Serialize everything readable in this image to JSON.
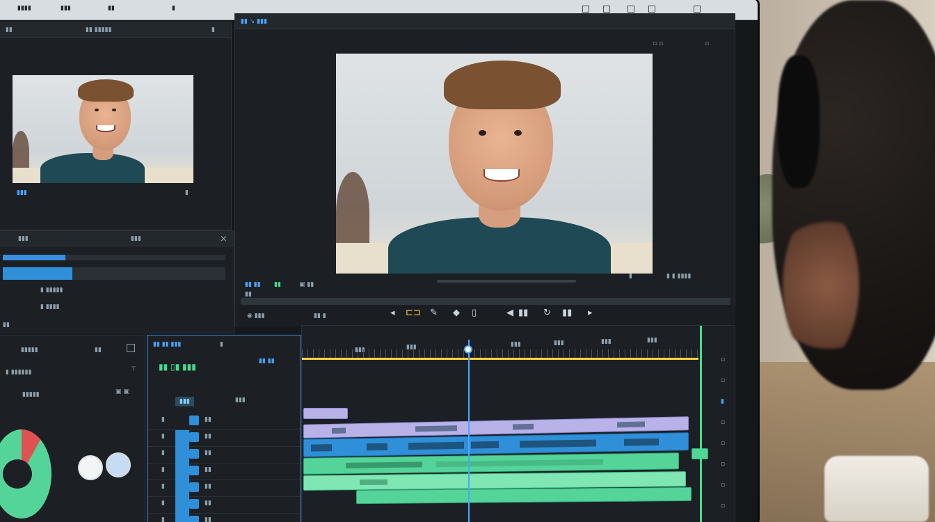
{
  "colors": {
    "accent": "#4aa3ff",
    "timeline_video": "#2f8fd8",
    "timeline_audio": "#55d49a",
    "timeline_title": "#b8b2e8",
    "playhead_line": "#ffd23f",
    "in_out_marker": "#3fe08a"
  },
  "source_monitor": {
    "icon_names": [
      "film-icon",
      "settings-icon"
    ]
  },
  "program_monitor": {
    "tab_label": "▮▮ ↘ ▮▮▮"
  },
  "effects_panel": {
    "close_icon": "×",
    "progress_fraction": 0.28
  },
  "transport": {
    "icons": [
      "play-icon",
      "step-back-icon",
      "loop-icon",
      "marker-icon",
      "in-point-icon",
      "out-point-icon"
    ]
  },
  "color_panel": {
    "wheel_red_fraction": 0.08
  },
  "timeline": {
    "timecode": "▮▮ ▯▮ ▮▮▮",
    "playhead_fraction": 0.42,
    "tracks": [
      "V3",
      "V2",
      "V1",
      "A1",
      "A2",
      "A3",
      "A4"
    ]
  }
}
